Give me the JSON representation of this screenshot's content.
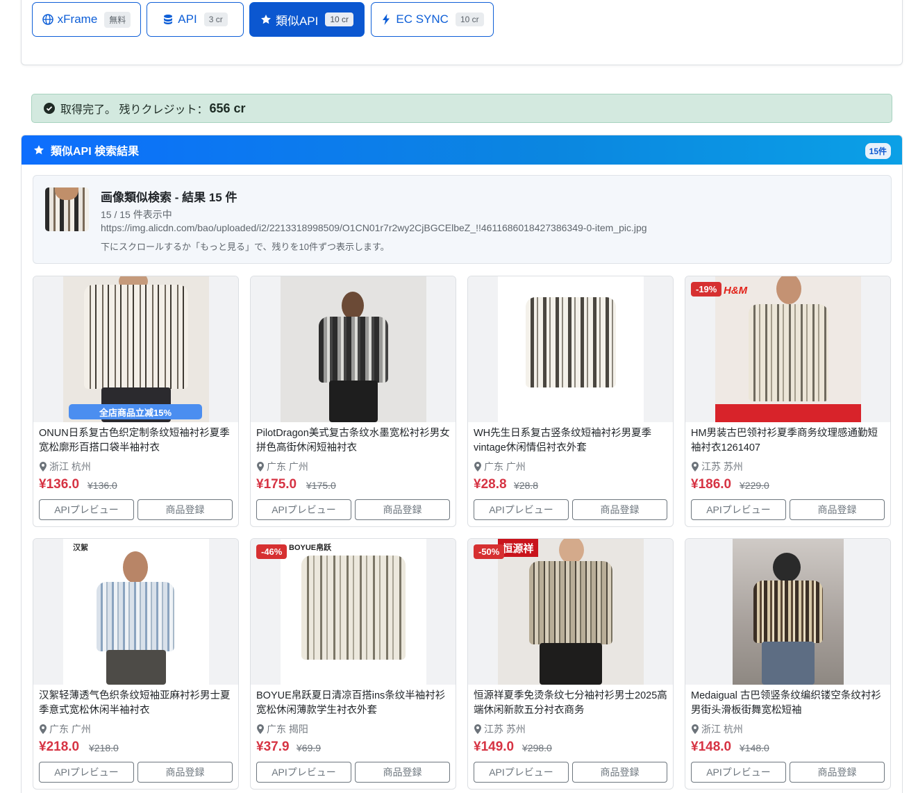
{
  "tabs": [
    {
      "label": "xFrame",
      "badge": "無料",
      "icon": "globe-icon"
    },
    {
      "label": "API",
      "badge": "3 cr",
      "icon": "database-icon"
    },
    {
      "label": "類似API",
      "badge": "10 cr",
      "icon": "star-icon",
      "active": true
    },
    {
      "label": "EC SYNC",
      "badge": "10 cr",
      "icon": "bolt-icon"
    }
  ],
  "alert": {
    "text": "取得完了。 残りクレジット：",
    "credits": "656 cr"
  },
  "results": {
    "header": "類似API 検索結果",
    "count": "15件",
    "info_title": "画像類似検索 - 結果 15 件",
    "info_shown": "15 / 15 件表示中",
    "info_url": "https://img.alicdn.com/bao/uploaded/i2/2213318998509/O1CN01r7r2wy2CjBGCElbeZ_!!4611686018427386349-0-item_pic.jpg",
    "info_hint": "下にスクロールするか「もっと見る」で、残りを10件ずつ表示します。"
  },
  "buttons": {
    "preview": "APIプレビュー",
    "register": "商品登録"
  },
  "products": [
    {
      "title": "ONUN日系复古色织定制条纹短袖衬衫夏季宽松廓形百搭口袋半袖衬衣",
      "location": "浙江 杭州",
      "price": "¥136.0",
      "original": "¥136.0",
      "discount": "",
      "overlay": "全店商品立减15%"
    },
    {
      "title": "PilotDragon美式复古条纹水墨宽松衬衫男女拼色高街休闲短袖衬衣",
      "location": "广东 广州",
      "price": "¥175.0",
      "original": "¥175.0",
      "discount": "",
      "overlay": ""
    },
    {
      "title": "WH先生日系复古竖条纹短袖衬衫男夏季vintage休闲情侣衬衣外套",
      "location": "广东 广州",
      "price": "¥28.8",
      "original": "¥28.8",
      "discount": "",
      "overlay": ""
    },
    {
      "title": "HM男装古巴领衬衫夏季商务纹理感通勤短袖衬衣1261407",
      "location": "江苏 苏州",
      "price": "¥186.0",
      "original": "¥229.0",
      "discount": "-19%",
      "overlay": "H&M"
    },
    {
      "title": "汉絮轻薄透气色织条纹短袖亚麻衬衫男士夏季意式宽松休闲半袖衬衣",
      "location": "广东 广州",
      "price": "¥218.0",
      "original": "¥218.0",
      "discount": "",
      "overlay": "汉絮"
    },
    {
      "title": "BOYUE帛跃夏日清凉百搭ins条纹半袖衬衫宽松休闲薄款学生衬衣外套",
      "location": "广东 揭阳",
      "price": "¥37.9",
      "original": "¥69.9",
      "discount": "-46%",
      "overlay": "BOYUE帛跃"
    },
    {
      "title": "恒源祥夏季免烫条纹七分袖衬衫男士2025高端休闲新款五分衬衣商务",
      "location": "江苏 苏州",
      "price": "¥149.0",
      "original": "¥298.0",
      "discount": "-50%",
      "overlay": "恒源祥"
    },
    {
      "title": "Medaigual 古巴领竖条纹编织镂空条纹衬衫男街头滑板街舞宽松短袖",
      "location": "浙江 杭州",
      "price": "¥148.0",
      "original": "¥148.0",
      "discount": "",
      "overlay": ""
    }
  ],
  "colors": {
    "primary": "#0b57d0",
    "price": "#d63343",
    "discount": "#d63031",
    "alert_bg": "#d3e9df"
  }
}
